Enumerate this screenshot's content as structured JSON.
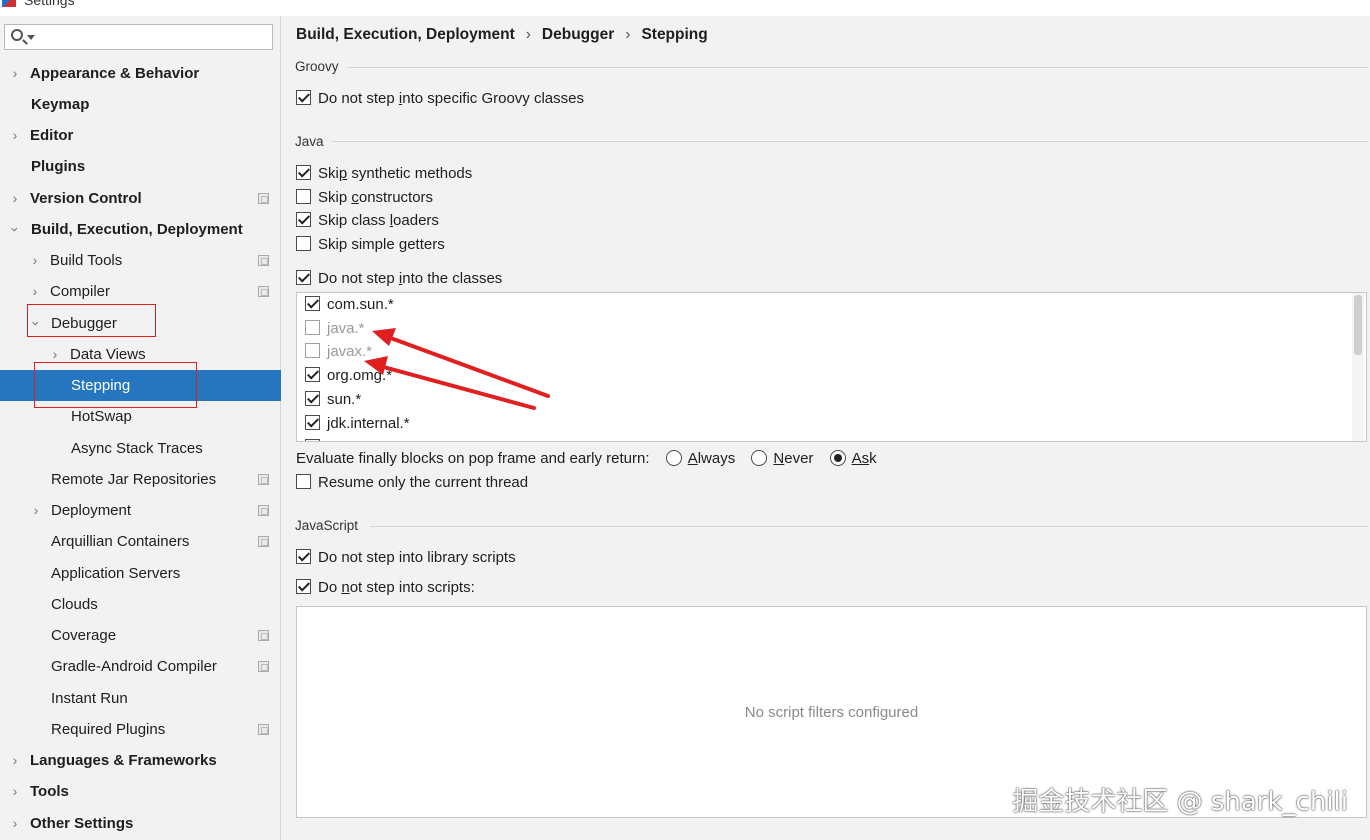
{
  "window": {
    "title": "Settings"
  },
  "search": {
    "placeholder": ""
  },
  "sidebar": {
    "items": [
      {
        "label": "Appearance & Behavior"
      },
      {
        "label": "Keymap"
      },
      {
        "label": "Editor"
      },
      {
        "label": "Plugins"
      },
      {
        "label": "Version Control"
      },
      {
        "label": "Build, Execution, Deployment"
      },
      {
        "label": "Build Tools"
      },
      {
        "label": "Compiler"
      },
      {
        "label": "Debugger"
      },
      {
        "label": "Data Views"
      },
      {
        "label": "Stepping"
      },
      {
        "label": "HotSwap"
      },
      {
        "label": "Async Stack Traces"
      },
      {
        "label": "Remote Jar Repositories"
      },
      {
        "label": "Deployment"
      },
      {
        "label": "Arquillian Containers"
      },
      {
        "label": "Application Servers"
      },
      {
        "label": "Clouds"
      },
      {
        "label": "Coverage"
      },
      {
        "label": "Gradle-Android Compiler"
      },
      {
        "label": "Instant Run"
      },
      {
        "label": "Required Plugins"
      },
      {
        "label": "Languages & Frameworks"
      },
      {
        "label": "Tools"
      },
      {
        "label": "Other Settings"
      }
    ]
  },
  "breadcrumb": {
    "part1": "Build, Execution, Deployment",
    "sep": "›",
    "part2": "Debugger",
    "part3": "Stepping"
  },
  "groovy": {
    "title": "Groovy",
    "no_step_groovy": {
      "pre": "Do not step ",
      "u": "i",
      "post": "nto specific Groovy classes",
      "checked": true
    }
  },
  "java": {
    "title": "Java",
    "skip_synthetic": {
      "pre": "Ski",
      "u": "p",
      "post": " synthetic methods",
      "checked": true
    },
    "skip_constructors": {
      "pre": "Skip ",
      "u": "c",
      "post": "onstructors",
      "checked": false
    },
    "skip_class_loaders": {
      "pre": "Skip class ",
      "u": "l",
      "post": "oaders",
      "checked": true
    },
    "skip_simple_getters": {
      "pre": "Skip simple ",
      "u": "g",
      "post": "etters",
      "checked": false
    },
    "no_step_classes": {
      "pre": "Do not step ",
      "u": "i",
      "post": "nto the classes",
      "checked": true
    },
    "class_filters": [
      {
        "pattern": "com.sun.*",
        "checked": true,
        "enabled": true
      },
      {
        "pattern": "java.*",
        "checked": false,
        "enabled": false
      },
      {
        "pattern": "javax.*",
        "checked": false,
        "enabled": false
      },
      {
        "pattern": "org.omg.*",
        "checked": true,
        "enabled": true
      },
      {
        "pattern": "sun.*",
        "checked": true,
        "enabled": true
      },
      {
        "pattern": "jdk.internal.*",
        "checked": true,
        "enabled": true
      }
    ],
    "evaluate_finally": {
      "label": "Evaluate finally blocks on pop frame and early return:",
      "options": [
        {
          "u": "A",
          "rest": "lways",
          "selected": false
        },
        {
          "u": "N",
          "rest": "ever",
          "selected": false
        },
        {
          "u": "As",
          "rest": "k",
          "selected": true
        }
      ]
    },
    "resume_current_thread": {
      "label": "Resume only the current thread",
      "checked": false
    }
  },
  "javascript": {
    "title": "JavaScript",
    "no_step_library": {
      "label": "Do not step into library scripts",
      "checked": true
    },
    "no_step_scripts": {
      "pre": "Do ",
      "u": "n",
      "post": "ot step into scripts:",
      "checked": true
    },
    "empty_text": "No script filters configured"
  },
  "watermark": "掘金技术社区 @ shark_chili",
  "colors": {
    "selection": "#2675bf",
    "annotation": "#e02020"
  }
}
